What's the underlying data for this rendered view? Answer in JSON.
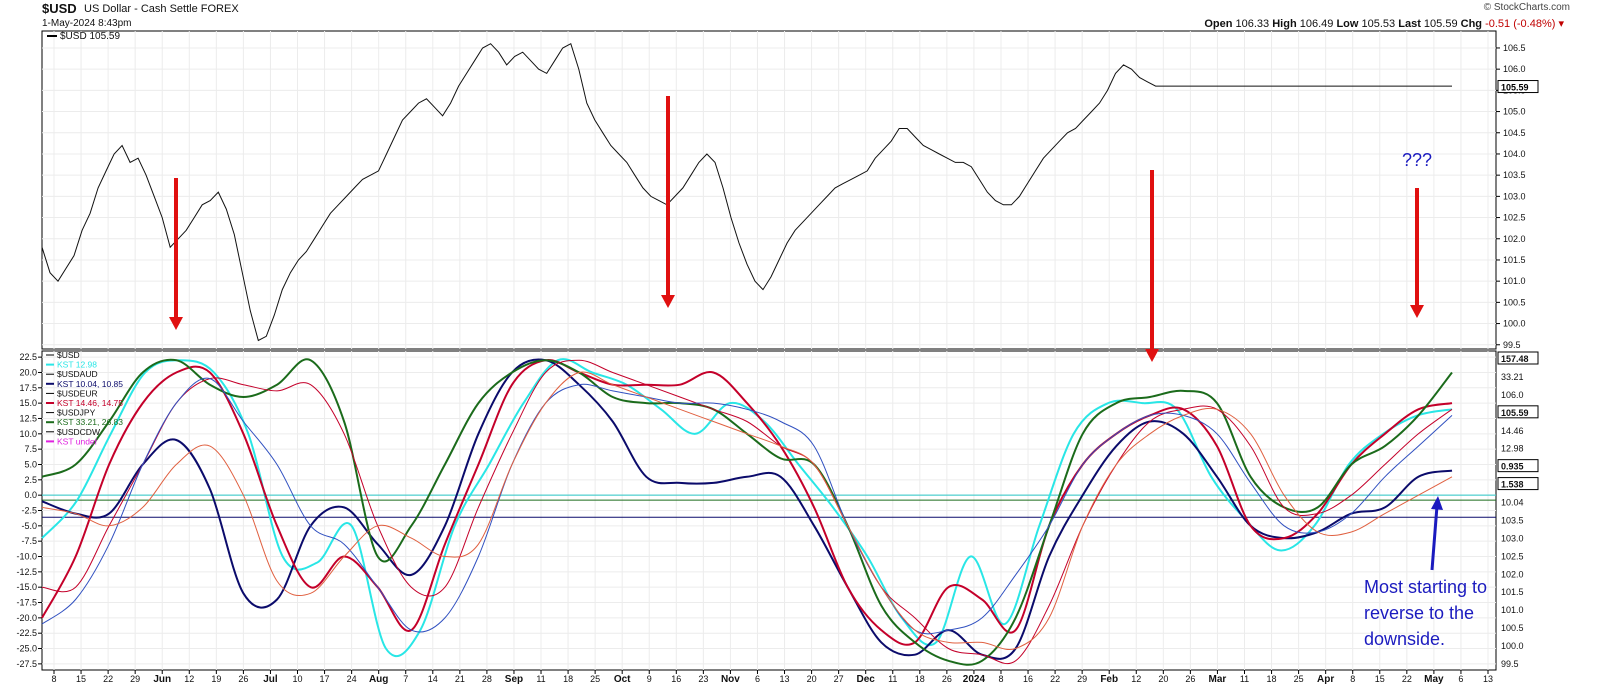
{
  "header": {
    "symbol": "$USD",
    "symbol_name": "US Dollar - Cash Settle",
    "exchange": "FOREX",
    "datetime": "1-May-2024 8:43pm",
    "copyright": "© StockCharts.com",
    "open_label": "Open",
    "open": "106.33",
    "high_label": "High",
    "high": "106.49",
    "low_label": "Low",
    "low": "105.53",
    "last_label": "Last",
    "last": "105.59",
    "chg_label": "Chg",
    "chg": "-0.51 (-0.48%)"
  },
  "annotations": {
    "question": "???",
    "note_lines": [
      "Most starting to",
      "reverse to the",
      "downside."
    ]
  },
  "chart_data": [
    {
      "type": "line",
      "panel": "price",
      "legend": "$USD 105.59",
      "ylim": [
        99.4,
        106.9
      ],
      "y_ticks": [
        "106.5",
        "106.0",
        "105.5",
        "105.0",
        "104.5",
        "104.0",
        "103.5",
        "103.0",
        "102.5",
        "102.0",
        "101.5",
        "101.0",
        "100.5",
        "100.0",
        "99.5"
      ],
      "last_label": "105.59",
      "x": [
        0,
        8,
        16,
        24,
        32,
        40,
        48,
        56,
        64,
        72,
        80,
        88,
        96,
        104,
        112,
        120,
        128,
        136,
        144,
        152,
        160,
        168,
        176,
        184,
        192,
        200,
        208,
        216,
        224,
        232,
        240,
        248,
        256,
        264,
        272,
        280,
        288,
        296,
        304,
        312,
        320,
        328,
        336,
        344,
        352,
        360,
        368,
        376,
        384,
        392,
        400,
        408,
        416,
        424,
        432,
        440,
        448,
        456,
        464,
        472,
        480,
        488,
        496,
        504,
        512,
        520,
        528,
        536,
        544,
        552,
        560,
        568,
        576,
        584,
        592,
        600,
        608,
        616,
        624,
        632,
        640,
        648,
        656,
        664,
        672,
        680,
        688,
        696,
        704,
        712,
        720,
        728,
        736,
        744,
        752,
        760,
        768,
        776,
        784,
        792,
        800,
        808,
        816,
        824,
        832,
        840,
        848,
        856,
        864,
        872,
        880,
        888,
        896,
        904,
        912,
        920,
        928,
        936,
        944,
        952,
        960,
        968,
        976,
        984,
        992,
        1000,
        1008,
        1016,
        1024,
        1032,
        1040,
        1048,
        1056,
        1064,
        1072,
        1080,
        1088,
        1096,
        1104,
        1112,
        1120,
        1128,
        1136,
        1144,
        1152,
        1160,
        1168,
        1176,
        1184,
        1192,
        1200,
        1208,
        1216,
        1224,
        1232,
        1240,
        1248,
        1256,
        1264,
        1272,
        1280,
        1288,
        1296,
        1304,
        1312,
        1320,
        1328,
        1336,
        1344,
        1352,
        1360,
        1368,
        1376,
        1384,
        1392,
        1400,
        1408
      ],
      "values": [
        101.8,
        101.2,
        101.0,
        101.3,
        101.6,
        102.2,
        102.6,
        103.2,
        103.6,
        104.0,
        104.2,
        103.8,
        103.9,
        103.5,
        103.0,
        102.5,
        101.8,
        102.0,
        102.2,
        102.5,
        102.8,
        102.9,
        103.1,
        102.7,
        102.1,
        101.2,
        100.3,
        99.6,
        99.7,
        100.2,
        100.8,
        101.2,
        101.5,
        101.7,
        102.0,
        102.3,
        102.6,
        102.8,
        103.0,
        103.2,
        103.4,
        103.5,
        103.6,
        104.0,
        104.4,
        104.8,
        105.0,
        105.2,
        105.3,
        105.1,
        104.9,
        105.2,
        105.6,
        105.9,
        106.2,
        106.5,
        106.6,
        106.4,
        106.1,
        106.3,
        106.4,
        106.2,
        106.0,
        105.9,
        106.2,
        106.5,
        106.6,
        106.0,
        105.2,
        104.8,
        104.5,
        104.2,
        104.0,
        103.8,
        103.5,
        103.2,
        103.0,
        102.9,
        102.8,
        103.0,
        103.2,
        103.5,
        103.8,
        104.0,
        103.8,
        103.2,
        102.5,
        101.9,
        101.4,
        101.0,
        100.8,
        101.1,
        101.5,
        101.9,
        102.2,
        102.4,
        102.6,
        102.8,
        103.0,
        103.2,
        103.3,
        103.4,
        103.5,
        103.6,
        103.9,
        104.1,
        104.3,
        104.6,
        104.6,
        104.4,
        104.2,
        104.1,
        104.0,
        103.9,
        103.8,
        103.8,
        103.7,
        103.4,
        103.1,
        102.9,
        102.8,
        102.8,
        103.0,
        103.3,
        103.6,
        103.9,
        104.1,
        104.3,
        104.5,
        104.6,
        104.8,
        105.0,
        105.2,
        105.5,
        105.9,
        106.1,
        106.0,
        105.8,
        105.7,
        105.6,
        105.6,
        105.6,
        105.6,
        105.6,
        105.6,
        105.6,
        105.6,
        105.6,
        105.6,
        105.6,
        105.6,
        105.6,
        105.6,
        105.6,
        105.6,
        105.6,
        105.6,
        105.6,
        105.6,
        105.6,
        105.6,
        105.6,
        105.6,
        105.6,
        105.6,
        105.6,
        105.6,
        105.6,
        105.6,
        105.6,
        105.6,
        105.6,
        105.6,
        105.6,
        105.6,
        105.6,
        105.6
      ]
    },
    {
      "type": "line",
      "panel": "kst",
      "ylim": [
        -28.5,
        23.5
      ],
      "y_ticks": [
        "22.5",
        "20.0",
        "17.5",
        "15.0",
        "12.5",
        "10.0",
        "7.5",
        "5.0",
        "2.5",
        "0.0",
        "-2.5",
        "-5.0",
        "-7.5",
        "-10.0",
        "-12.5",
        "-15.0",
        "-17.5",
        "-20.0",
        "-22.5",
        "-25.0",
        "-27.5"
      ],
      "right_labels": [
        "157.48",
        "33.21",
        "106.0",
        "105.59",
        "14.46",
        "12.98",
        "0.935",
        "1.538",
        "10.04",
        "103.5",
        "103.0",
        "102.5",
        "102.0",
        "101.5",
        "101.0",
        "100.5",
        "100.0",
        "99.5"
      ],
      "legend": [
        {
          "label": "$USD"
        },
        {
          "label": "KST 12.98",
          "color": "#29e6e6"
        },
        {
          "label": "$USDAUD"
        },
        {
          "label": "KST 10.04, 10.85",
          "color": "#0b0b6b"
        },
        {
          "label": "$USDEUR"
        },
        {
          "label": "KST 14.46, 14.75",
          "color": "#c4002a"
        },
        {
          "label": "$USDJPY"
        },
        {
          "label": "KST 33.21, 26.83",
          "color": "#1b6b1b"
        },
        {
          "label": "$USDCDW"
        },
        {
          "label": "KST undef",
          "color": "#e020e0"
        }
      ],
      "series": [
        {
          "color": "#29e6e6",
          "x_start": 0,
          "x_step": 40,
          "values": [
            -7,
            -1,
            10,
            20,
            22,
            20,
            10,
            -10,
            -11,
            -5,
            -25,
            -22,
            -5,
            5,
            15,
            22,
            20,
            18,
            14,
            10,
            15,
            12,
            5,
            -2,
            -10,
            -20,
            -24,
            -10,
            -21,
            -5,
            10,
            15,
            15,
            14,
            3,
            -4,
            -9,
            -5,
            5,
            10,
            13,
            14
          ]
        },
        {
          "color": "#0b0b6b",
          "x_start": 0,
          "x_step": 40,
          "values": [
            -1,
            -3,
            -3,
            5,
            9,
            1,
            -16,
            -17,
            -5,
            -2,
            -8,
            -13,
            -5,
            10,
            20,
            22,
            18,
            12,
            3,
            2,
            2,
            3,
            3,
            -5,
            -15,
            -24,
            -26,
            -22,
            -26,
            -25,
            -10,
            0,
            8,
            12,
            10,
            3,
            -5,
            -7,
            -6,
            -3,
            -2,
            3,
            4
          ]
        },
        {
          "color": "#c4002a",
          "x_start": 0,
          "x_step": 40,
          "values": [
            -20,
            -10,
            5,
            15,
            20,
            20,
            10,
            -5,
            -15,
            -10,
            -15,
            -22,
            -8,
            5,
            18,
            22,
            20,
            18,
            18,
            18,
            20,
            15,
            8,
            -2,
            -15,
            -22,
            -24,
            -15,
            -17,
            -22,
            -5,
            5,
            10,
            13,
            14,
            8,
            -5,
            -7,
            -3,
            5,
            10,
            14,
            15
          ]
        },
        {
          "color": "#1b6b1b",
          "x_start": 0,
          "x_step": 40,
          "values": [
            3,
            5,
            12,
            20,
            22,
            18,
            16,
            18,
            22,
            12,
            -10,
            -5,
            5,
            15,
            20,
            22,
            20,
            16,
            15,
            15,
            14,
            10,
            6,
            5,
            -5,
            -18,
            -24,
            -27,
            -27,
            -20,
            -5,
            10,
            15,
            16,
            17,
            15,
            3,
            -2,
            -2,
            5,
            8,
            13,
            20
          ]
        },
        {
          "color": "#c4002a",
          "x_start": 0,
          "x_step": 40,
          "values": [
            -15,
            -15,
            -5,
            5,
            15,
            19,
            18,
            17,
            18,
            10,
            -5,
            -15,
            -15,
            -2,
            10,
            20,
            22,
            20,
            18,
            16,
            14,
            12,
            8,
            5,
            -5,
            -15,
            -20,
            -25,
            -26,
            -27,
            -18,
            -5,
            5,
            12,
            14,
            14,
            8,
            -2,
            -3,
            0,
            5,
            10,
            14
          ]
        },
        {
          "color": "#3050c0",
          "x_start": 0,
          "x_step": 40,
          "values": [
            -21,
            -17,
            -8,
            5,
            15,
            19,
            12,
            5,
            -5,
            -8,
            -15,
            -22,
            -20,
            -10,
            5,
            15,
            18,
            17,
            16,
            15,
            15,
            14,
            12,
            8,
            -5,
            -15,
            -22,
            -22,
            -20,
            -13,
            -5,
            5,
            10,
            13,
            13,
            10,
            2,
            -5,
            -6,
            -3,
            3,
            8,
            13
          ]
        },
        {
          "color": "#e06040",
          "x_start": 0,
          "x_step": 40,
          "values": [
            -2,
            -3,
            -5,
            -2,
            5,
            8,
            0,
            -14,
            -16,
            -10,
            -5,
            -7,
            -10,
            -8,
            5,
            15,
            20,
            18,
            16,
            14,
            12,
            10,
            8,
            5,
            -5,
            -15,
            -22,
            -24,
            -24,
            -25,
            -20,
            -5,
            5,
            10,
            13,
            14,
            10,
            0,
            -6,
            -6,
            -3,
            0,
            3
          ]
        }
      ],
      "hlines": [
        0.0,
        -0.8,
        -3.6
      ]
    }
  ],
  "x_axis": {
    "ticks": [
      "8",
      "15",
      "22",
      "29",
      "Jun",
      "12",
      "19",
      "26",
      "Jul",
      "10",
      "17",
      "24",
      "Aug",
      "7",
      "14",
      "21",
      "28",
      "Sep",
      "11",
      "18",
      "25",
      "Oct",
      "9",
      "16",
      "23",
      "Nov",
      "6",
      "13",
      "20",
      "27",
      "Dec",
      "11",
      "18",
      "26",
      "2024",
      "8",
      "16",
      "22",
      "29",
      "Feb",
      "12",
      "20",
      "26",
      "Mar",
      "11",
      "18",
      "25",
      "Apr",
      "8",
      "15",
      "22",
      "May",
      "6",
      "13"
    ],
    "bold": [
      "Jun",
      "Jul",
      "Aug",
      "Sep",
      "Oct",
      "Nov",
      "Dec",
      "2024",
      "Feb",
      "Mar",
      "Apr",
      "May"
    ]
  },
  "colors": {
    "arrow": "#e01010",
    "blue_annotation": "#1b1bbf",
    "price_line": "#111111"
  }
}
